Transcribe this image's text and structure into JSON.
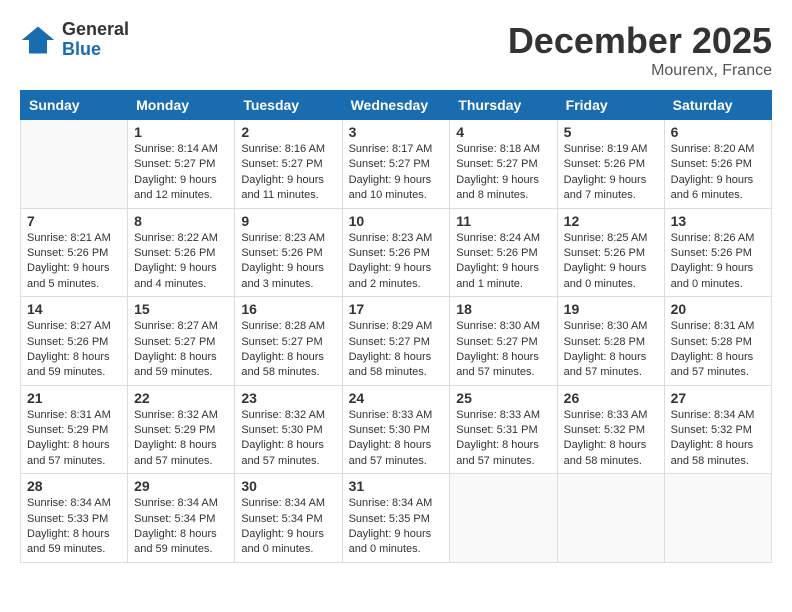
{
  "header": {
    "logo_general": "General",
    "logo_blue": "Blue",
    "month_year": "December 2025",
    "location": "Mourenx, France"
  },
  "columns": [
    "Sunday",
    "Monday",
    "Tuesday",
    "Wednesday",
    "Thursday",
    "Friday",
    "Saturday"
  ],
  "weeks": [
    [
      {
        "day": "",
        "sunrise": "",
        "sunset": "",
        "daylight": ""
      },
      {
        "day": "1",
        "sunrise": "Sunrise: 8:14 AM",
        "sunset": "Sunset: 5:27 PM",
        "daylight": "Daylight: 9 hours and 12 minutes."
      },
      {
        "day": "2",
        "sunrise": "Sunrise: 8:16 AM",
        "sunset": "Sunset: 5:27 PM",
        "daylight": "Daylight: 9 hours and 11 minutes."
      },
      {
        "day": "3",
        "sunrise": "Sunrise: 8:17 AM",
        "sunset": "Sunset: 5:27 PM",
        "daylight": "Daylight: 9 hours and 10 minutes."
      },
      {
        "day": "4",
        "sunrise": "Sunrise: 8:18 AM",
        "sunset": "Sunset: 5:27 PM",
        "daylight": "Daylight: 9 hours and 8 minutes."
      },
      {
        "day": "5",
        "sunrise": "Sunrise: 8:19 AM",
        "sunset": "Sunset: 5:26 PM",
        "daylight": "Daylight: 9 hours and 7 minutes."
      },
      {
        "day": "6",
        "sunrise": "Sunrise: 8:20 AM",
        "sunset": "Sunset: 5:26 PM",
        "daylight": "Daylight: 9 hours and 6 minutes."
      }
    ],
    [
      {
        "day": "7",
        "sunrise": "Sunrise: 8:21 AM",
        "sunset": "Sunset: 5:26 PM",
        "daylight": "Daylight: 9 hours and 5 minutes."
      },
      {
        "day": "8",
        "sunrise": "Sunrise: 8:22 AM",
        "sunset": "Sunset: 5:26 PM",
        "daylight": "Daylight: 9 hours and 4 minutes."
      },
      {
        "day": "9",
        "sunrise": "Sunrise: 8:23 AM",
        "sunset": "Sunset: 5:26 PM",
        "daylight": "Daylight: 9 hours and 3 minutes."
      },
      {
        "day": "10",
        "sunrise": "Sunrise: 8:23 AM",
        "sunset": "Sunset: 5:26 PM",
        "daylight": "Daylight: 9 hours and 2 minutes."
      },
      {
        "day": "11",
        "sunrise": "Sunrise: 8:24 AM",
        "sunset": "Sunset: 5:26 PM",
        "daylight": "Daylight: 9 hours and 1 minute."
      },
      {
        "day": "12",
        "sunrise": "Sunrise: 8:25 AM",
        "sunset": "Sunset: 5:26 PM",
        "daylight": "Daylight: 9 hours and 0 minutes."
      },
      {
        "day": "13",
        "sunrise": "Sunrise: 8:26 AM",
        "sunset": "Sunset: 5:26 PM",
        "daylight": "Daylight: 9 hours and 0 minutes."
      }
    ],
    [
      {
        "day": "14",
        "sunrise": "Sunrise: 8:27 AM",
        "sunset": "Sunset: 5:26 PM",
        "daylight": "Daylight: 8 hours and 59 minutes."
      },
      {
        "day": "15",
        "sunrise": "Sunrise: 8:27 AM",
        "sunset": "Sunset: 5:27 PM",
        "daylight": "Daylight: 8 hours and 59 minutes."
      },
      {
        "day": "16",
        "sunrise": "Sunrise: 8:28 AM",
        "sunset": "Sunset: 5:27 PM",
        "daylight": "Daylight: 8 hours and 58 minutes."
      },
      {
        "day": "17",
        "sunrise": "Sunrise: 8:29 AM",
        "sunset": "Sunset: 5:27 PM",
        "daylight": "Daylight: 8 hours and 58 minutes."
      },
      {
        "day": "18",
        "sunrise": "Sunrise: 8:30 AM",
        "sunset": "Sunset: 5:27 PM",
        "daylight": "Daylight: 8 hours and 57 minutes."
      },
      {
        "day": "19",
        "sunrise": "Sunrise: 8:30 AM",
        "sunset": "Sunset: 5:28 PM",
        "daylight": "Daylight: 8 hours and 57 minutes."
      },
      {
        "day": "20",
        "sunrise": "Sunrise: 8:31 AM",
        "sunset": "Sunset: 5:28 PM",
        "daylight": "Daylight: 8 hours and 57 minutes."
      }
    ],
    [
      {
        "day": "21",
        "sunrise": "Sunrise: 8:31 AM",
        "sunset": "Sunset: 5:29 PM",
        "daylight": "Daylight: 8 hours and 57 minutes."
      },
      {
        "day": "22",
        "sunrise": "Sunrise: 8:32 AM",
        "sunset": "Sunset: 5:29 PM",
        "daylight": "Daylight: 8 hours and 57 minutes."
      },
      {
        "day": "23",
        "sunrise": "Sunrise: 8:32 AM",
        "sunset": "Sunset: 5:30 PM",
        "daylight": "Daylight: 8 hours and 57 minutes."
      },
      {
        "day": "24",
        "sunrise": "Sunrise: 8:33 AM",
        "sunset": "Sunset: 5:30 PM",
        "daylight": "Daylight: 8 hours and 57 minutes."
      },
      {
        "day": "25",
        "sunrise": "Sunrise: 8:33 AM",
        "sunset": "Sunset: 5:31 PM",
        "daylight": "Daylight: 8 hours and 57 minutes."
      },
      {
        "day": "26",
        "sunrise": "Sunrise: 8:33 AM",
        "sunset": "Sunset: 5:32 PM",
        "daylight": "Daylight: 8 hours and 58 minutes."
      },
      {
        "day": "27",
        "sunrise": "Sunrise: 8:34 AM",
        "sunset": "Sunset: 5:32 PM",
        "daylight": "Daylight: 8 hours and 58 minutes."
      }
    ],
    [
      {
        "day": "28",
        "sunrise": "Sunrise: 8:34 AM",
        "sunset": "Sunset: 5:33 PM",
        "daylight": "Daylight: 8 hours and 59 minutes."
      },
      {
        "day": "29",
        "sunrise": "Sunrise: 8:34 AM",
        "sunset": "Sunset: 5:34 PM",
        "daylight": "Daylight: 8 hours and 59 minutes."
      },
      {
        "day": "30",
        "sunrise": "Sunrise: 8:34 AM",
        "sunset": "Sunset: 5:34 PM",
        "daylight": "Daylight: 9 hours and 0 minutes."
      },
      {
        "day": "31",
        "sunrise": "Sunrise: 8:34 AM",
        "sunset": "Sunset: 5:35 PM",
        "daylight": "Daylight: 9 hours and 0 minutes."
      },
      {
        "day": "",
        "sunrise": "",
        "sunset": "",
        "daylight": ""
      },
      {
        "day": "",
        "sunrise": "",
        "sunset": "",
        "daylight": ""
      },
      {
        "day": "",
        "sunrise": "",
        "sunset": "",
        "daylight": ""
      }
    ]
  ]
}
